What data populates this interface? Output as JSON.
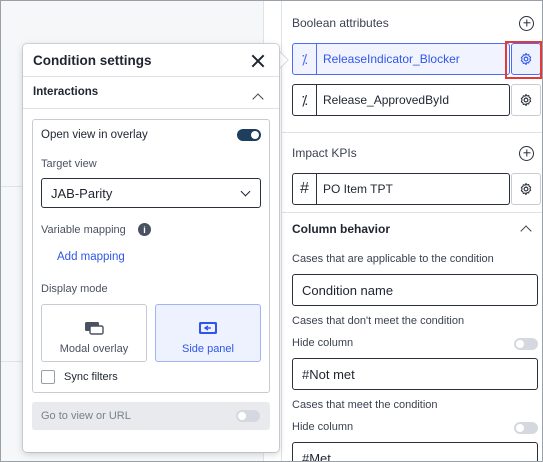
{
  "popover": {
    "title": "Condition settings",
    "section_title": "Interactions",
    "open_view_label": "Open view in overlay",
    "open_view_enabled": true,
    "target_view_label": "Target view",
    "target_view_value": "JAB-Parity",
    "variable_mapping_label": "Variable mapping",
    "add_mapping_label": "Add mapping",
    "display_mode_label": "Display mode",
    "display_modes": [
      {
        "label": "Modal overlay",
        "icon": "modal-overlay-icon",
        "selected": false
      },
      {
        "label": "Side panel",
        "icon": "side-panel-icon",
        "selected": true
      }
    ],
    "sync_filters_label": "Sync filters",
    "sync_filters_checked": false,
    "go_to_view_label": "Go to view or URL",
    "go_to_view_enabled": false
  },
  "right_panel": {
    "boolean_section_title": "Boolean attributes",
    "boolean_attributes": [
      {
        "name": "ReleaseIndicator_Blocker",
        "icon": "percent-icon",
        "active": true
      },
      {
        "name": "Release_ApprovedById",
        "icon": "percent-icon",
        "active": false
      }
    ],
    "kpi_section_title": "Impact KPIs",
    "kpis": [
      {
        "name": "PO Item TPT",
        "icon": "hash-icon"
      }
    ],
    "column_behavior_title": "Column behavior",
    "applicable_label": "Cases that are applicable to the condition",
    "applicable_value": "Condition name",
    "not_meet_label": "Cases that don't meet the condition",
    "hide_column_label_1": "Hide column",
    "not_met_value": "#Not met",
    "meet_label": "Cases that meet the condition",
    "hide_column_label_2": "Hide column",
    "met_value": "#Met"
  },
  "colors": {
    "accent": "#2f56e8",
    "highlight_border": "#e53935",
    "toggle_on": "#1f3d5c"
  }
}
